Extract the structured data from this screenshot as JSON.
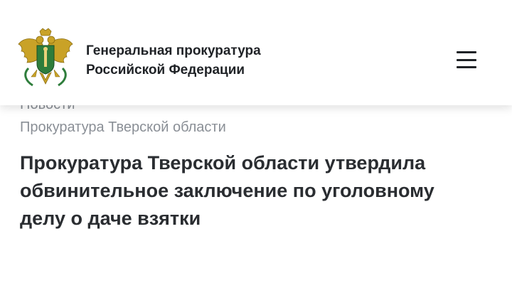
{
  "header": {
    "org_name_line1": "Генеральная прокуратура",
    "org_name_line2": "Российской Федерации",
    "logo_icon": "prosecutor-emblem-icon",
    "menu_icon": "hamburger-menu-icon"
  },
  "breadcrumb": {
    "clipped_text": "Новости",
    "current": "Прокуратура Тверской области"
  },
  "article": {
    "title_lines": [
      "Прокуратура Тверской области утвердила",
      "обвинительное заключение по уголовному",
      "делу о даче взятки"
    ]
  },
  "colors": {
    "text_dark": "#2a2d31",
    "text_muted": "#8a8f96",
    "emblem_gold": "#c9a227",
    "emblem_green": "#2e7d3b",
    "background": "#ffffff"
  }
}
